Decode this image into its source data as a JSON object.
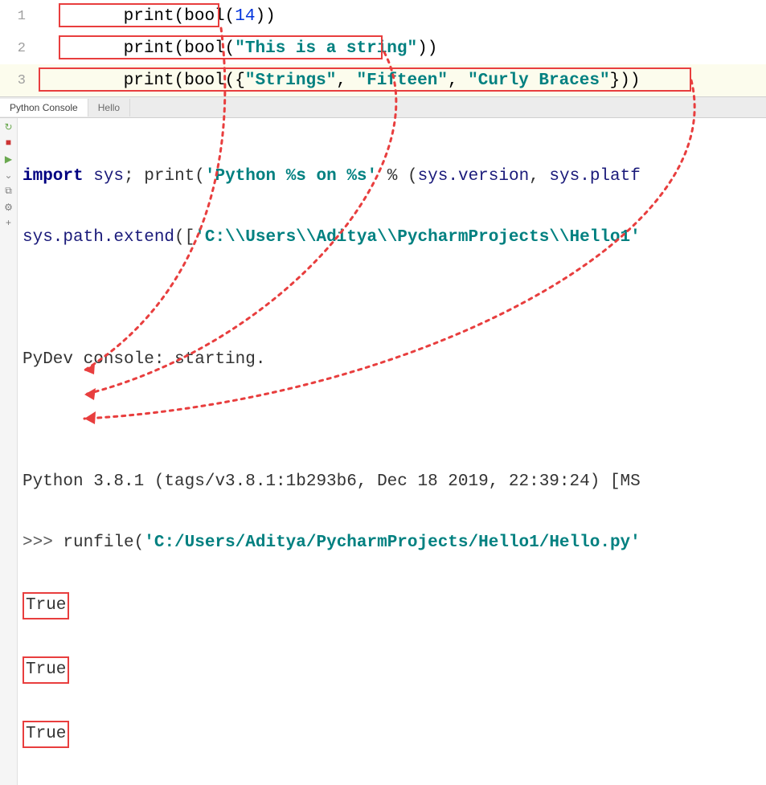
{
  "editor": {
    "lines": [
      {
        "num": "1",
        "tokens": [
          {
            "t": "fn",
            "v": "print"
          },
          {
            "t": "paren",
            "v": "("
          },
          {
            "t": "fn",
            "v": "bool"
          },
          {
            "t": "paren",
            "v": "("
          },
          {
            "t": "num",
            "v": "14"
          },
          {
            "t": "paren",
            "v": "))"
          }
        ],
        "active": false
      },
      {
        "num": "2",
        "tokens": [
          {
            "t": "fn",
            "v": "print"
          },
          {
            "t": "paren",
            "v": "("
          },
          {
            "t": "fn",
            "v": "bool"
          },
          {
            "t": "paren",
            "v": "("
          },
          {
            "t": "str",
            "v": "\"This is a string\""
          },
          {
            "t": "paren",
            "v": "))"
          }
        ],
        "active": false
      },
      {
        "num": "3",
        "tokens": [
          {
            "t": "fn",
            "v": "print"
          },
          {
            "t": "paren",
            "v": "("
          },
          {
            "t": "fn",
            "v": "bool"
          },
          {
            "t": "paren",
            "v": "("
          },
          {
            "t": "brace",
            "v": "{"
          },
          {
            "t": "str",
            "v": "\"Strings\""
          },
          {
            "t": "paren",
            "v": ", "
          },
          {
            "t": "str",
            "v": "\"Fifteen\""
          },
          {
            "t": "paren",
            "v": ", "
          },
          {
            "t": "str",
            "v": "\"Curly Braces\""
          },
          {
            "t": "brace",
            "v": "}"
          },
          {
            "t": "paren",
            "v": "))"
          }
        ],
        "active": true
      }
    ]
  },
  "tabs": {
    "console": "Python Console",
    "file": "Hello"
  },
  "toolbar": {
    "icons": [
      "rerun",
      "stop",
      "run",
      "debug",
      "history",
      "settings",
      "add"
    ]
  },
  "console": {
    "line_import": {
      "kw1": "import",
      "id1": " sys",
      "sep": "; ",
      "fn": "print",
      "paren1": "(",
      "str": "'Python %s on %s'",
      "op": " % (",
      "id2": "sys.version",
      "comma": ", ",
      "id3": "sys.platf"
    },
    "line_extend": {
      "id": "sys.path.extend",
      "paren": "([",
      "str": "'C:\\\\Users\\\\Aditya\\\\PycharmProjects\\\\Hello1'"
    },
    "line_pydev": "PyDev console: starting.",
    "line_version": "Python 3.8.1 (tags/v3.8.1:1b293b6, Dec 18 2019, 22:39:24) [MS",
    "line_run": {
      "prompt": ">>> ",
      "fn": "runfile",
      "paren": "(",
      "str": "'C:/Users/Aditya/PycharmProjects/Hello1/Hello.py'"
    },
    "out1": "True",
    "out2": "True",
    "out3": "True"
  }
}
